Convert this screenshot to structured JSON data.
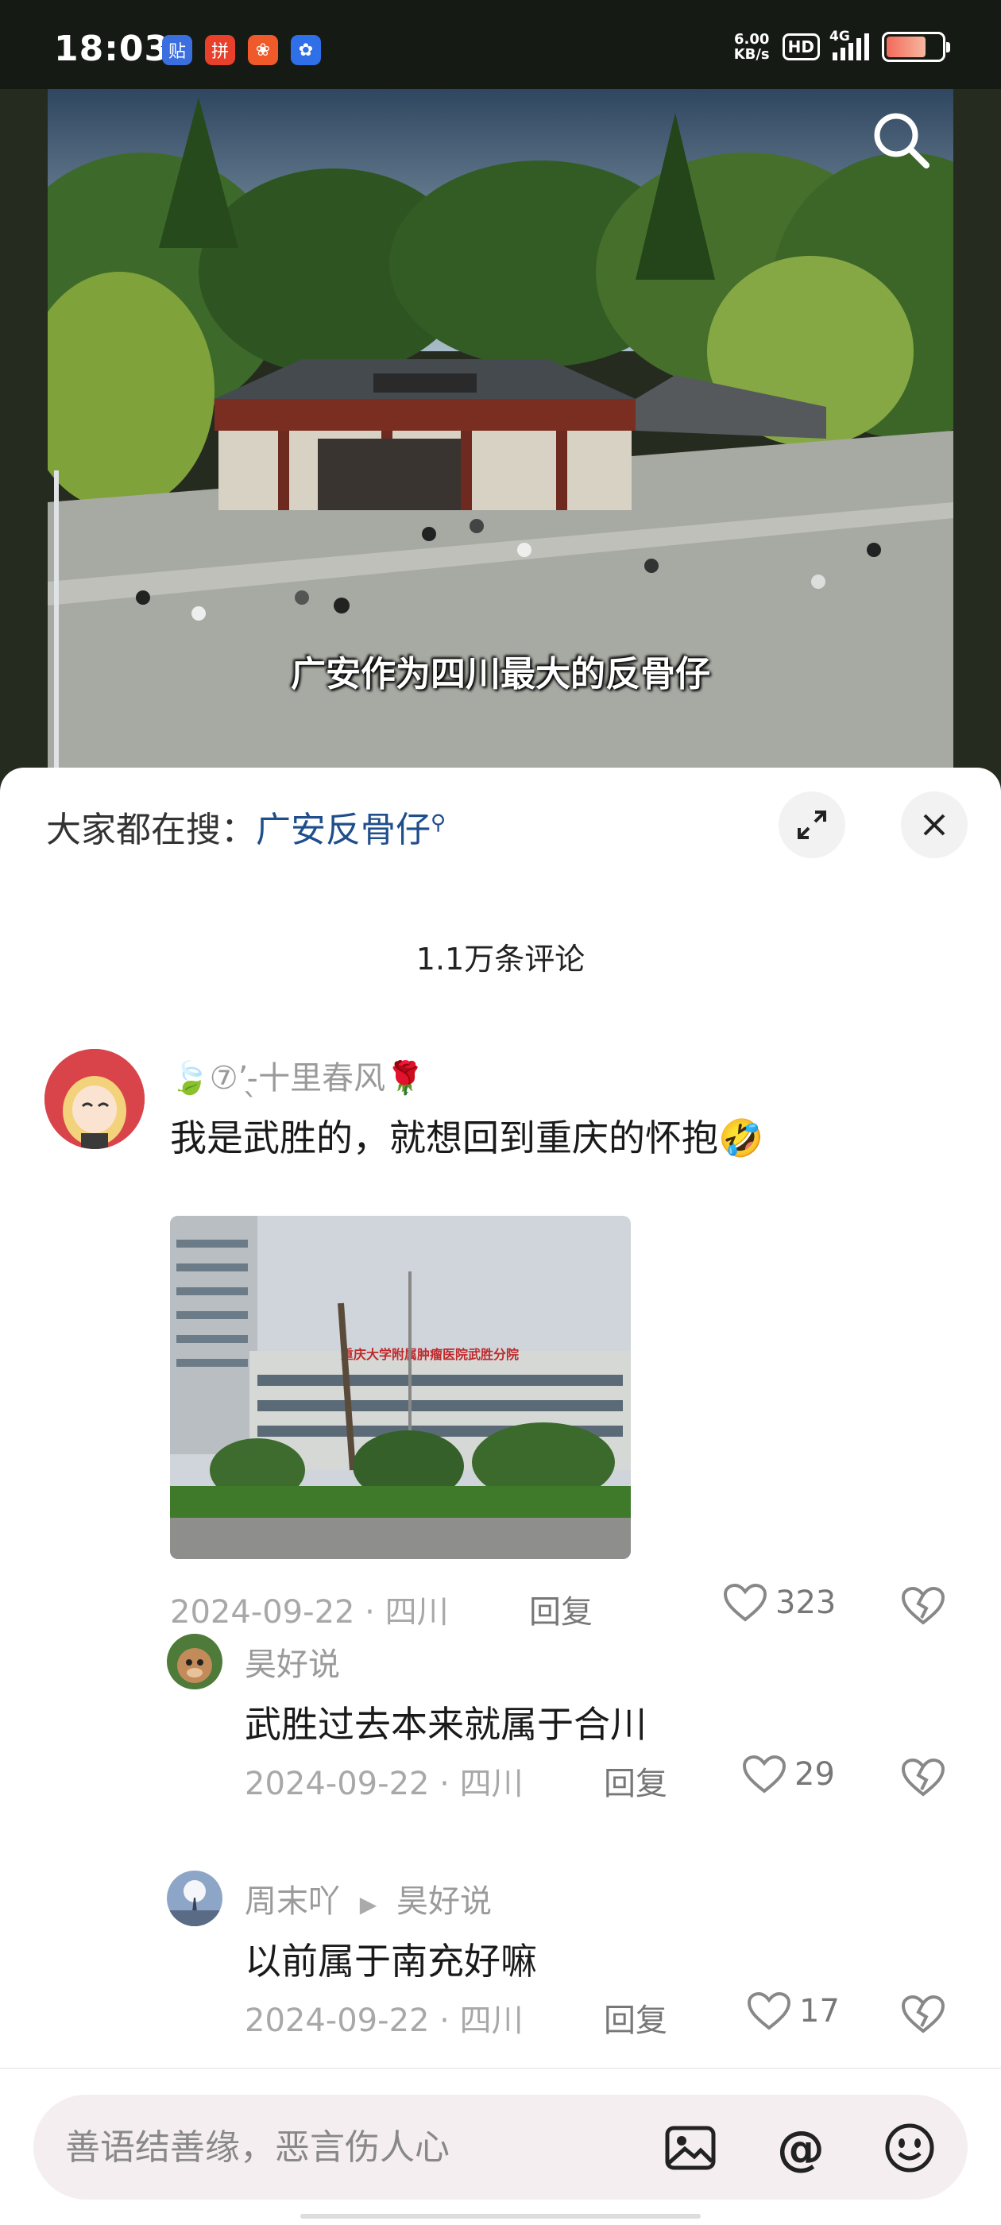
{
  "status_bar": {
    "time": "18:03",
    "net_speed_value": "6.00",
    "net_speed_unit": "KB/s",
    "hd_label": "HD",
    "network_label": "4G",
    "battery_level_percent": 72,
    "app_icons": [
      "tieba-icon",
      "pinduoduo-icon",
      "app-store-icon",
      "baidu-paw-icon"
    ]
  },
  "video": {
    "caption": "广安作为四川最大的反骨仔"
  },
  "comment_sheet": {
    "trending_prefix": "大家都在搜：",
    "trending_keyword": "广安反骨仔",
    "comment_count": "1.1万条评论",
    "comments": [
      {
        "username": "🍃⑦’ ̵̖十里春风🌹",
        "text": "我是武胜的，就想回到重庆的怀抱🤣",
        "date": "2024-09-22",
        "location": "四川",
        "reply_label": "回复",
        "likes": "323",
        "photo_sign_text": "重庆大学附属肿瘤医院武胜分院"
      }
    ],
    "replies": [
      {
        "username": "昊好说",
        "reply_to": "",
        "text": "武胜过去本来就属于合川",
        "date": "2024-09-22",
        "location": "四川",
        "reply_label": "回复",
        "likes": "29"
      },
      {
        "username": "周末吖",
        "reply_to": "昊好说",
        "text": "以前属于南充好嘛",
        "date": "2024-09-22",
        "location": "四川",
        "reply_label": "回复",
        "likes": "17"
      }
    ]
  },
  "input_bar": {
    "placeholder": "善语结善缘，恶言伤人心"
  },
  "colors": {
    "keyword_blue": "#1f4e8c",
    "sheet_bg": "#ffffff",
    "input_bg": "#f5eef1"
  }
}
